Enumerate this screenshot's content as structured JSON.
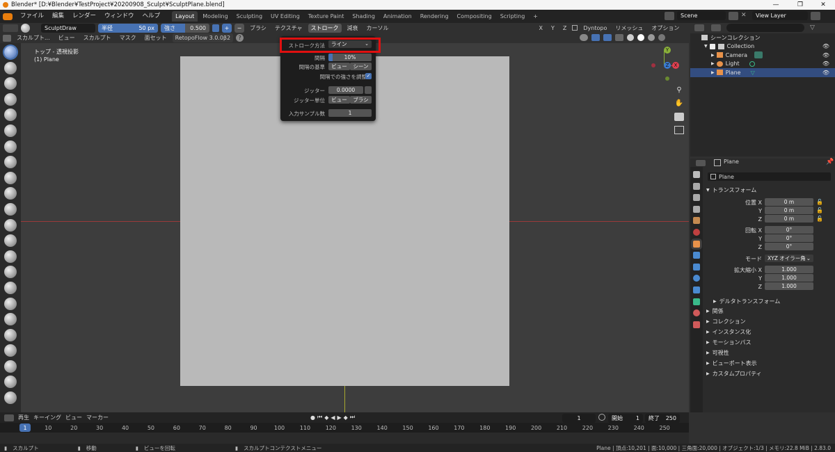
{
  "window": {
    "title": "Blender* [D:¥Blender¥TestProject¥20200908_Sculpt¥SculptPlane.blend]",
    "minimize": "—",
    "maximize": "❐",
    "close": "✕"
  },
  "menubar": {
    "items": [
      "ファイル",
      "編集",
      "レンダー",
      "ウィンドウ",
      "ヘルプ"
    ],
    "workspaces": [
      "Layout",
      "Modeling",
      "Sculpting",
      "UV Editing",
      "Texture Paint",
      "Shading",
      "Animation",
      "Rendering",
      "Compositing",
      "Scripting"
    ],
    "active_workspace": "Layout",
    "add_tab": "+",
    "scene": "Scene",
    "view_layer": "View Layer"
  },
  "tool_header": {
    "brush_name": "SculptDraw",
    "radius_label": "半径",
    "radius_value": "50 px",
    "strength_label": "強さ",
    "strength_value": "0.500",
    "plus": "+",
    "minus": "−",
    "menus": [
      "ブラシ",
      "テクスチャ",
      "ストローク",
      "減衰",
      "カーソル"
    ],
    "active_menu": "ストローク",
    "symmetry": [
      "X",
      "Y",
      "Z"
    ],
    "dyntopo": "Dyntopo",
    "remesh": "リメッシュ",
    "options": "オプション"
  },
  "editor_header": {
    "mode": "スカルプト...",
    "menus": [
      "ビュー",
      "スカルプト",
      "マスク",
      "面セット"
    ],
    "addon": "RetopoFlow 3.0.0β2",
    "help": "?"
  },
  "viewport": {
    "view_name": "トップ - 透視投影",
    "object_name": "(1) Plane",
    "axis_x": "X",
    "axis_y": "Y",
    "axis_z": "Z"
  },
  "stroke_popup": {
    "method_label": "ストローク方法",
    "method_value": "ライン",
    "spacing_label": "間隔",
    "spacing_value": "10%",
    "spacing_base_label": "間隔の基準",
    "spacing_base_options": [
      "ビュー",
      "シーン"
    ],
    "spacing_base_active": "ビュー",
    "adjust_strength_label": "間隔での強さを調整",
    "jitter_label": "ジッター",
    "jitter_value": "0.0000",
    "jitter_unit_label": "ジッター単位",
    "jitter_unit_options": [
      "ビュー",
      "ブラシ"
    ],
    "jitter_unit_active": "ブラシ",
    "input_samples_label": "入力サンプル数",
    "input_samples_value": "1"
  },
  "outliner": {
    "root": "シーンコレクション",
    "collection": "Collection",
    "items": [
      "Camera",
      "Light",
      "Plane"
    ],
    "selected": "Plane"
  },
  "properties": {
    "object_path": "Plane",
    "object_name": "Plane",
    "transform_header": "トランスフォーム",
    "location_label": "位置",
    "location": [
      "0 m",
      "0 m",
      "0 m"
    ],
    "rotation_label": "回転",
    "rotation": [
      "0°",
      "0°",
      "0°"
    ],
    "mode_label": "モード",
    "mode_value": "XYZ オイラー角",
    "scale_label": "拡大縮小",
    "scale": [
      "1.000",
      "1.000",
      "1.000"
    ],
    "axes": [
      "X",
      "Y",
      "Z"
    ],
    "delta": "デルタトランスフォーム",
    "panels": [
      "関係",
      "コレクション",
      "インスタンス化",
      "モーションパス",
      "可視性",
      "ビューポート表示",
      "カスタムプロパティ"
    ]
  },
  "timeline": {
    "menus": [
      "再生",
      "キーイング",
      "ビュー",
      "マーカー"
    ],
    "current_frame": "1",
    "start_label": "開始",
    "start_value": "1",
    "end_label": "終了",
    "end_value": "250",
    "ruler": [
      "1",
      "10",
      "20",
      "30",
      "40",
      "50",
      "60",
      "70",
      "80",
      "90",
      "100",
      "110",
      "120",
      "130",
      "140",
      "150",
      "160",
      "170",
      "180",
      "190",
      "200",
      "210",
      "220",
      "230",
      "240",
      "250"
    ]
  },
  "statusbar": {
    "left_items": [
      "スカルプト",
      "移動",
      "ビューを回転",
      "スカルプトコンテクストメニュー"
    ],
    "stats": "Plane | 頂点:10,201 | 面:10,000 | 三角面:20,000 | オブジェクト:1/3 | メモリ:22.8 MiB | 2.83.0"
  },
  "colors": {
    "accent": "#4772b3",
    "highlight": "#e01010",
    "bg": "#303030"
  }
}
